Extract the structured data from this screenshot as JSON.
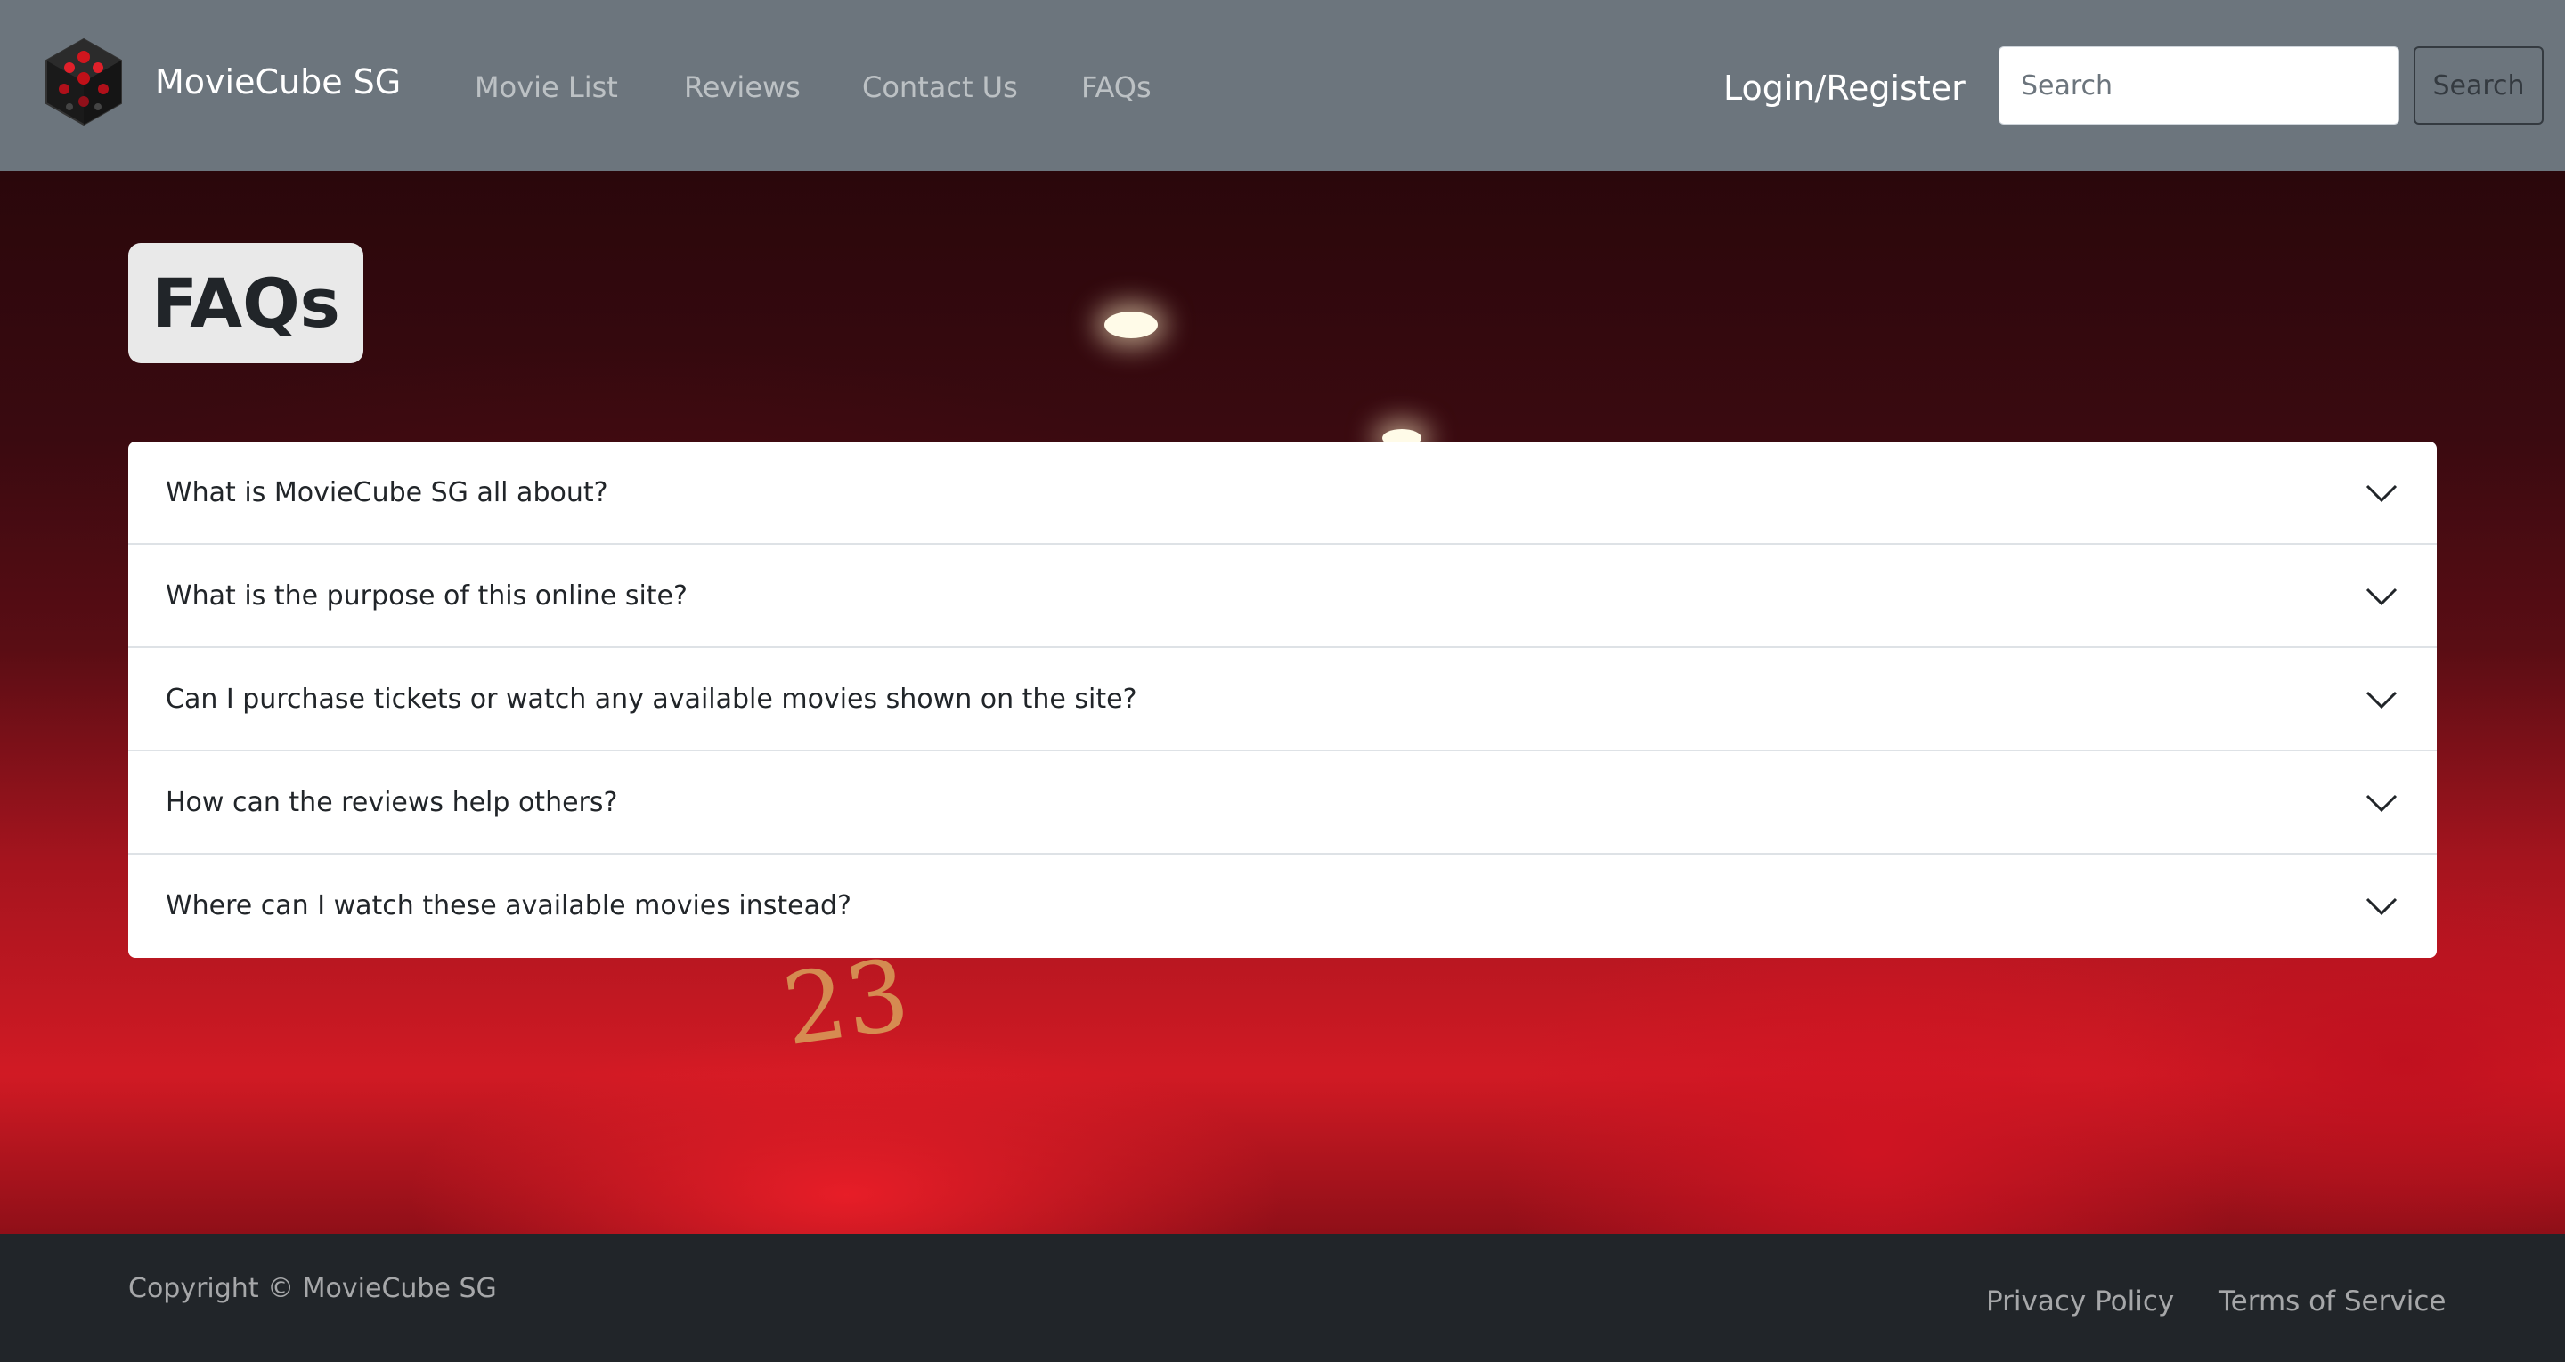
{
  "navbar": {
    "brand": "MovieCube SG",
    "logo_icon": "cube-logo-icon",
    "links": [
      {
        "label": "Movie List"
      },
      {
        "label": "Reviews"
      },
      {
        "label": "Contact Us"
      },
      {
        "label": "FAQs"
      }
    ],
    "login_label": "Login/Register",
    "search": {
      "placeholder": "Search",
      "value": "",
      "button_label": "Search"
    }
  },
  "hero": {
    "seat_number": "23"
  },
  "faq": {
    "title": "FAQs",
    "questions": [
      "What is MovieCube SG all about?",
      "What is the purpose of this online site?",
      "Can I purchase tickets or watch any available movies shown on the site?",
      "How can the reviews help others?",
      "Where can I watch these available movies instead?"
    ],
    "chevron_icon": "chevron-down-icon"
  },
  "footer": {
    "copyright": "Copyright © MovieCube SG",
    "links": [
      {
        "label": "Privacy Policy"
      },
      {
        "label": "Terms of Service"
      }
    ]
  },
  "colors": {
    "navbar_bg": "#6c757d",
    "footer_bg": "#212529",
    "title_box_bg": "#e9e9e9",
    "accent_red": "#d11a24"
  }
}
